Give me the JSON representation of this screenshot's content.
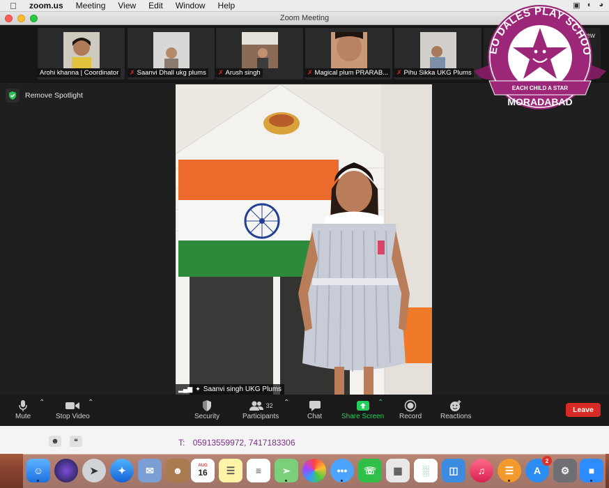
{
  "menubar": {
    "app": "zoom.us",
    "items": [
      "Meeting",
      "View",
      "Edit",
      "Window",
      "Help"
    ]
  },
  "window": {
    "title": "Zoom Meeting"
  },
  "participants_strip": [
    {
      "name": "Arohi khanna | Coordinator",
      "muted": false
    },
    {
      "name": "Saanvi Dhall ukg plums",
      "muted": true
    },
    {
      "name": "Arush singh",
      "muted": true
    },
    {
      "name": "Magical plum PRARAB...",
      "muted": true
    },
    {
      "name": "Pihu Sikka UKG Plums",
      "muted": true
    }
  ],
  "strip_view_label": "ew",
  "spotlight": {
    "label": "Remove Spotlight"
  },
  "speaker": {
    "name": "Saanvi singh UKG Plums"
  },
  "toolbar": {
    "mute": "Mute",
    "stop_video": "Stop Video",
    "security": "Security",
    "participants": "Participants",
    "participants_count": "32",
    "chat": "Chat",
    "share_screen": "Share Screen",
    "record": "Record",
    "reactions": "Reactions",
    "leave": "Leave"
  },
  "school_badge": {
    "name": "NEO DALES PLAY SCHOOL",
    "tagline": "EACH CHILD A STAR",
    "city": "MORADABAD"
  },
  "below_window": {
    "contact_label": "T:",
    "phones": "05913559972, 7417183306"
  },
  "dock": {
    "calendar_month": "AUG",
    "calendar_day": "16",
    "appstore_badge": "2"
  },
  "colors": {
    "leave_red": "#d92b25",
    "share_green": "#24d05a",
    "badge_purple": "#9c2778"
  }
}
